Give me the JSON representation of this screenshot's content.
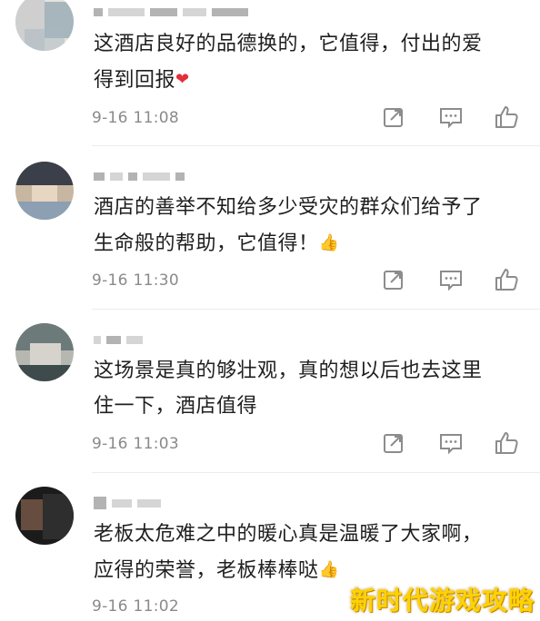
{
  "comments": [
    {
      "text_line1": "这酒店良好的品德换的，它值得，付出的爱",
      "text_line2": "得到回报",
      "emoji": "❤",
      "time": "9-16 11:08",
      "avatar_colors": [
        "#c9c9c9",
        "#e8e6e1",
        "#7f97a8"
      ]
    },
    {
      "text_line1": "酒店的善举不知给多少受灾的群众们给予了",
      "text_line2": "生命般的帮助，它值得！",
      "emoji": "👍",
      "time": "9-16 11:30",
      "avatar_colors": [
        "#3a3f49",
        "#c7b6a0",
        "#8c9fb3"
      ]
    },
    {
      "text_line1": "这场景是真的够壮观，真的想以后也去这里",
      "text_line2": "住一下，酒店值得",
      "emoji": "",
      "time": "9-16 11:03",
      "avatar_colors": [
        "#6d7a7a",
        "#b7b7b2",
        "#3f4a4c"
      ]
    },
    {
      "text_line1": "老板太危难之中的暖心真是温暖了大家啊，",
      "text_line2": "应得的荣誉，老板棒棒哒",
      "emoji": "👍",
      "time": "9-16 11:02",
      "avatar_colors": [
        "#1b1b1b",
        "#7a5a48",
        "#2e2e2e"
      ]
    }
  ],
  "icons": {
    "share": "share-icon",
    "reply": "reply-icon",
    "like": "thumbs-up-icon"
  },
  "watermark": "新时代游戏攻略"
}
